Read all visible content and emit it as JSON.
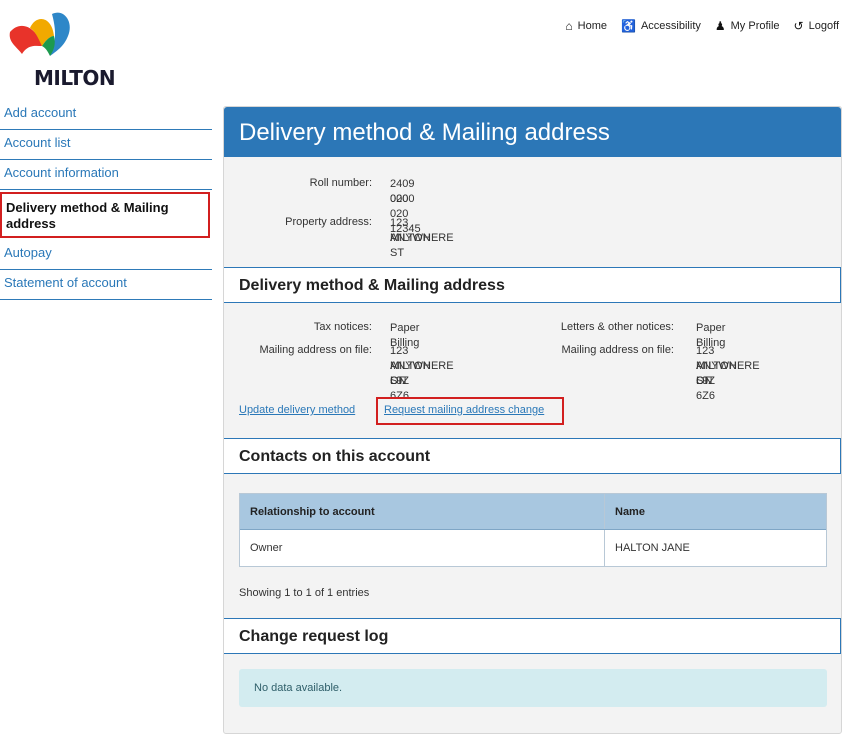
{
  "brand": {
    "logo_text": "MILTON"
  },
  "topnav": [
    {
      "label": "Home",
      "icon": "home-icon"
    },
    {
      "label": "Accessibility",
      "icon": "accessibility-icon"
    },
    {
      "label": "My Profile",
      "icon": "user-icon"
    },
    {
      "label": "Logoff",
      "icon": "logoff-icon"
    }
  ],
  "sidebar": {
    "items": [
      {
        "label": "Add account"
      },
      {
        "label": "Account list"
      },
      {
        "label": "Account information"
      },
      {
        "label": "Delivery method & Mailing address",
        "active": true
      },
      {
        "label": "Autopay"
      },
      {
        "label": "Statement of account"
      }
    ]
  },
  "main": {
    "title": "Delivery method & Mailing address",
    "roll_number_label": "Roll number:",
    "roll_number_line1": "2409 020 020 12345",
    "roll_number_line2": "0000",
    "property_address_label": "Property address:",
    "property_address_line1": "123 ANYWHERE ST",
    "property_address_line2": "MILTON",
    "delivery_section_title": "Delivery method & Mailing address",
    "tax_notices_label": "Tax notices:",
    "tax_notices_value": "Paper Billing",
    "tax_mailing_label": "Mailing address on file:",
    "tax_mailing_line1": "123 ANYWHERE ST",
    "tax_mailing_line2": "MILTON ON",
    "tax_mailing_line3": "L9Z 6Z6",
    "letters_label": "Letters & other notices:",
    "letters_value": "Paper Billing",
    "letters_mailing_label": "Mailing address on file:",
    "letters_mailing_line1": "123 ANYWHERE ST",
    "letters_mailing_line2": "MILTON ON",
    "letters_mailing_line3": "L9Z 6Z6",
    "update_delivery_link": "Update delivery method",
    "request_address_link": "Request mailing address change",
    "contacts_section_title": "Contacts on this account",
    "contacts_table": {
      "headers": [
        "Relationship to account",
        "Name"
      ],
      "rows": [
        [
          "Owner",
          "HALTON JANE"
        ]
      ]
    },
    "entries_text": "Showing 1 to 1 of 1 entries",
    "change_log_title": "Change request log",
    "no_data_text": "No data available."
  },
  "colors": {
    "accent": "#2c77b7",
    "highlight": "#d21f1f",
    "info_bg": "#d3ecf0"
  }
}
